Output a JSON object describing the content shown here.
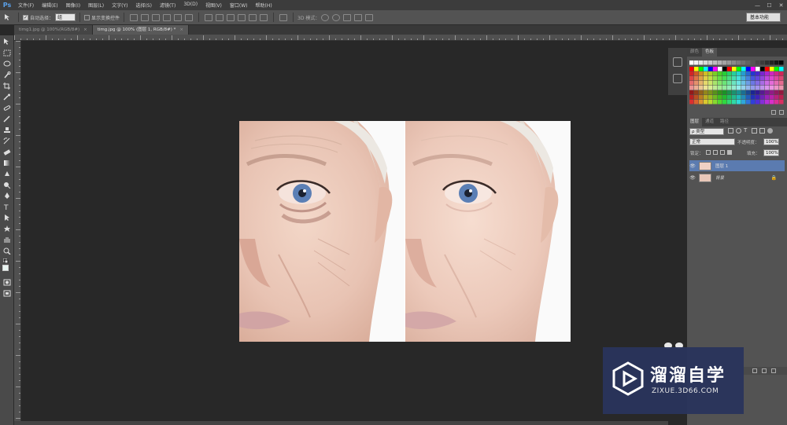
{
  "app": {
    "logo": "Ps"
  },
  "menu": [
    "文件(F)",
    "编辑(E)",
    "图像(I)",
    "图层(L)",
    "文字(Y)",
    "选择(S)",
    "滤镜(T)",
    "3D(D)",
    "视图(V)",
    "窗口(W)",
    "帮助(H)"
  ],
  "window_controls": {
    "minimize": "—",
    "maximize": "☐",
    "close": "✕"
  },
  "options_bar": {
    "auto_select_label": "自动选择：",
    "auto_select_value": "组",
    "show_transform_label": "显示变换控件",
    "mode_3d_label": "3D 模式：",
    "workspace": "基本功能"
  },
  "tabs": [
    {
      "label": "timg1.jpg @ 100%(RGB/8#)",
      "active": false
    },
    {
      "label": "timg.jpg @ 100% (图层 1, RGB/8#) *",
      "active": true
    }
  ],
  "swatches_panel": {
    "tabs": [
      "颜色",
      "色板"
    ],
    "active_tab": "色板"
  },
  "layers_panel": {
    "tabs": [
      "图层",
      "通道",
      "路径"
    ],
    "filter_kind": "ρ 类型",
    "blend_mode": "正常",
    "opacity_label": "不透明度：",
    "opacity_value": "100%",
    "lock_label": "锁定：",
    "fill_label": "填充：",
    "fill_value": "100%",
    "layers": [
      {
        "name": "图层 1",
        "visible": true,
        "selected": true,
        "locked": false
      },
      {
        "name": "背景",
        "visible": true,
        "selected": false,
        "locked": true
      }
    ]
  },
  "watermark": {
    "title": "溜溜自学",
    "url": "ZIXUE.3D66.COM"
  },
  "colors": {
    "accent": "#5a9be0",
    "panel": "#535353",
    "canvas_bg": "#282828",
    "selected_layer": "#5b7bb0",
    "watermark_bg": "#2a345c"
  }
}
